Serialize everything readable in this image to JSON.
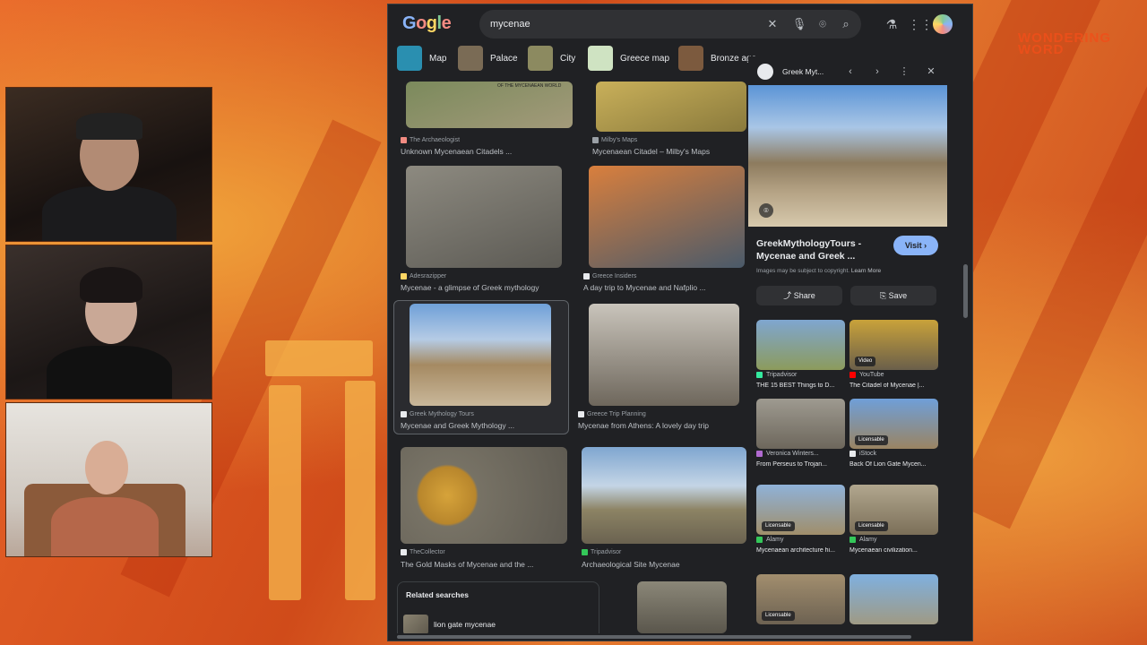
{
  "stream": {
    "brand_logo": "WONDERING WORD"
  },
  "browser": {
    "logo": [
      "G",
      "o",
      "g",
      "l",
      "e"
    ],
    "search": {
      "value": "mycenae",
      "clear_icon": "close-icon",
      "voice_icon": "mic-icon",
      "lens_icon": "camera-icon",
      "search_icon": "search-icon"
    },
    "chips": [
      {
        "label": "Map",
        "color": "#2a8fb0"
      },
      {
        "label": "Palace",
        "color": "#7a6b55"
      },
      {
        "label": "City",
        "color": "#8c8a60"
      },
      {
        "label": "Greece map",
        "color": "#cfe3c2"
      },
      {
        "label": "Bronze age",
        "color": "#7c5a3e"
      }
    ],
    "results": [
      {
        "source": "The Archaeologist",
        "title": "Unknown Mycenaean Citadels ...",
        "colors": [
          "#7b8a5c",
          "#a39a7a"
        ],
        "img_text": "OF THE MYCENAEAN WORLD"
      },
      {
        "source": "Milby's Maps",
        "title": "Mycenaean Citadel – Milby's Maps",
        "colors": [
          "#c9b05a",
          "#8a7a3c"
        ]
      },
      {
        "source": "Adesrazipper",
        "title": "Mycenae - a glimpse of Greek mythology",
        "colors": [
          "#8d8a80",
          "#5c5a54"
        ]
      },
      {
        "source": "Greece Insiders",
        "title": "A day trip to Mycenae and Nafplio ...",
        "colors": [
          "#d97f3d",
          "#4a5a6a"
        ]
      },
      {
        "source": "Greek Mythology Tours",
        "title": "Mycenae and Greek Mythology ...",
        "colors": [
          "#6fa0d8",
          "#a58a62"
        ]
      },
      {
        "source": "Greece Trip Planning",
        "title": "Mycenae from Athens: A lovely day trip",
        "colors": [
          "#c9c4bb",
          "#6e675c"
        ]
      },
      {
        "source": "TheCollector",
        "title": "The Gold Masks of Mycenae and the ...",
        "colors": [
          "#d6a33a",
          "#777265"
        ]
      },
      {
        "source": "Tripadvisor",
        "title": "Archaeological Site Mycenae",
        "colors": [
          "#7fa6d0",
          "#8c8364"
        ]
      }
    ],
    "related": {
      "heading": "Related searches",
      "item": "lion gate mycenae"
    },
    "panel": {
      "source": "Greek Myt...",
      "title": "GreekMythologyTours - Mycenae and Greek ...",
      "visit_label": "Visit",
      "copyright": "Images may be subject to copyright.",
      "learn_more": "Learn More",
      "share_label": "Share",
      "save_label": "Save",
      "related": [
        {
          "source": "Tripadvisor",
          "title": "THE 15 BEST Things to D...",
          "fav_color": "#34e89e",
          "colors": [
            "#7fa6d0",
            "#8c9b5c"
          ],
          "badge": ""
        },
        {
          "source": "YouTube",
          "title": "The Citadel of Mycenae |...",
          "fav_color": "#ff0000",
          "colors": [
            "#c9a23a",
            "#6a5f4a"
          ],
          "badge": "Video"
        },
        {
          "source": "Veronica Winters...",
          "title": "From Perseus to Trojan...",
          "fav_color": "#b06ad0",
          "colors": [
            "#9e9a90",
            "#6d675c"
          ],
          "badge": ""
        },
        {
          "source": "iStock",
          "title": "Back Of Lion Gate Mycen...",
          "fav_color": "#e8eaed",
          "colors": [
            "#6f9fd8",
            "#9a8462"
          ],
          "badge": "Licensable"
        },
        {
          "source": "Alamy",
          "title": "Mycenaean architecture hi...",
          "fav_color": "#34c759",
          "colors": [
            "#8fb2d8",
            "#a08e6a"
          ],
          "badge": "Licensable"
        },
        {
          "source": "Alamy",
          "title": "Mycenaean civilization...",
          "fav_color": "#34c759",
          "colors": [
            "#b1a78e",
            "#7b6f58"
          ],
          "badge": "Licensable"
        },
        {
          "source": "",
          "title": "",
          "fav_color": "#e8eaed",
          "colors": [
            "#a28e6e",
            "#6d6252"
          ],
          "badge": "Licensable"
        },
        {
          "source": "",
          "title": "",
          "fav_color": "#e8eaed",
          "colors": [
            "#7fb0df",
            "#9f9a84"
          ],
          "badge": ""
        }
      ]
    }
  }
}
